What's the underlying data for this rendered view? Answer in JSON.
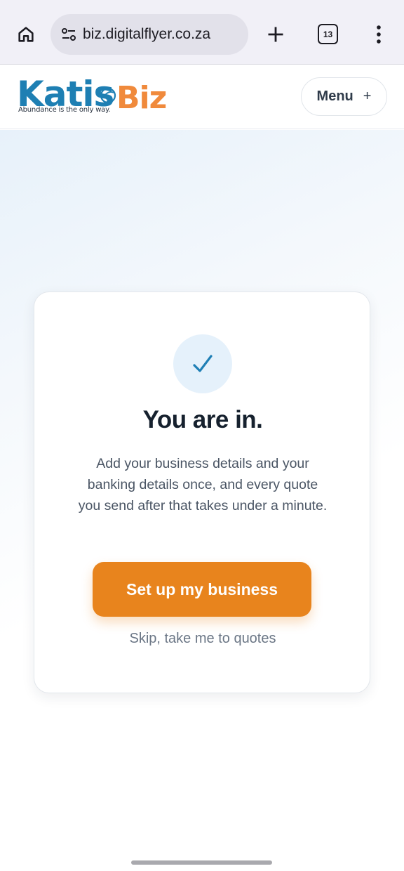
{
  "browser": {
    "url": "biz.digitalflyer.co.za",
    "tab_count": "13"
  },
  "site": {
    "logo_primary": "Katis",
    "logo_secondary": "Biz",
    "tagline": "Abundance is the only way.",
    "menu_label": "Menu",
    "menu_plus": "+"
  },
  "card": {
    "check_glyph": "✓",
    "title": "You are in.",
    "body": "Add your business details and your banking details once, and every quote you send after that takes under a minute.",
    "primary_button": "Set up my business",
    "skip_link": "Skip, take me to quotes"
  },
  "colors": {
    "accent_orange": "#e8841d",
    "brand_blue": "#1e7fb3",
    "brand_orange": "#f08a3c",
    "check_blue": "#1f7fb5"
  },
  "icons": {
    "home": "home-icon",
    "site_settings": "tune-icon",
    "new_tab": "plus-icon",
    "tabs": "tabs-icon",
    "more": "more-vert-icon"
  }
}
